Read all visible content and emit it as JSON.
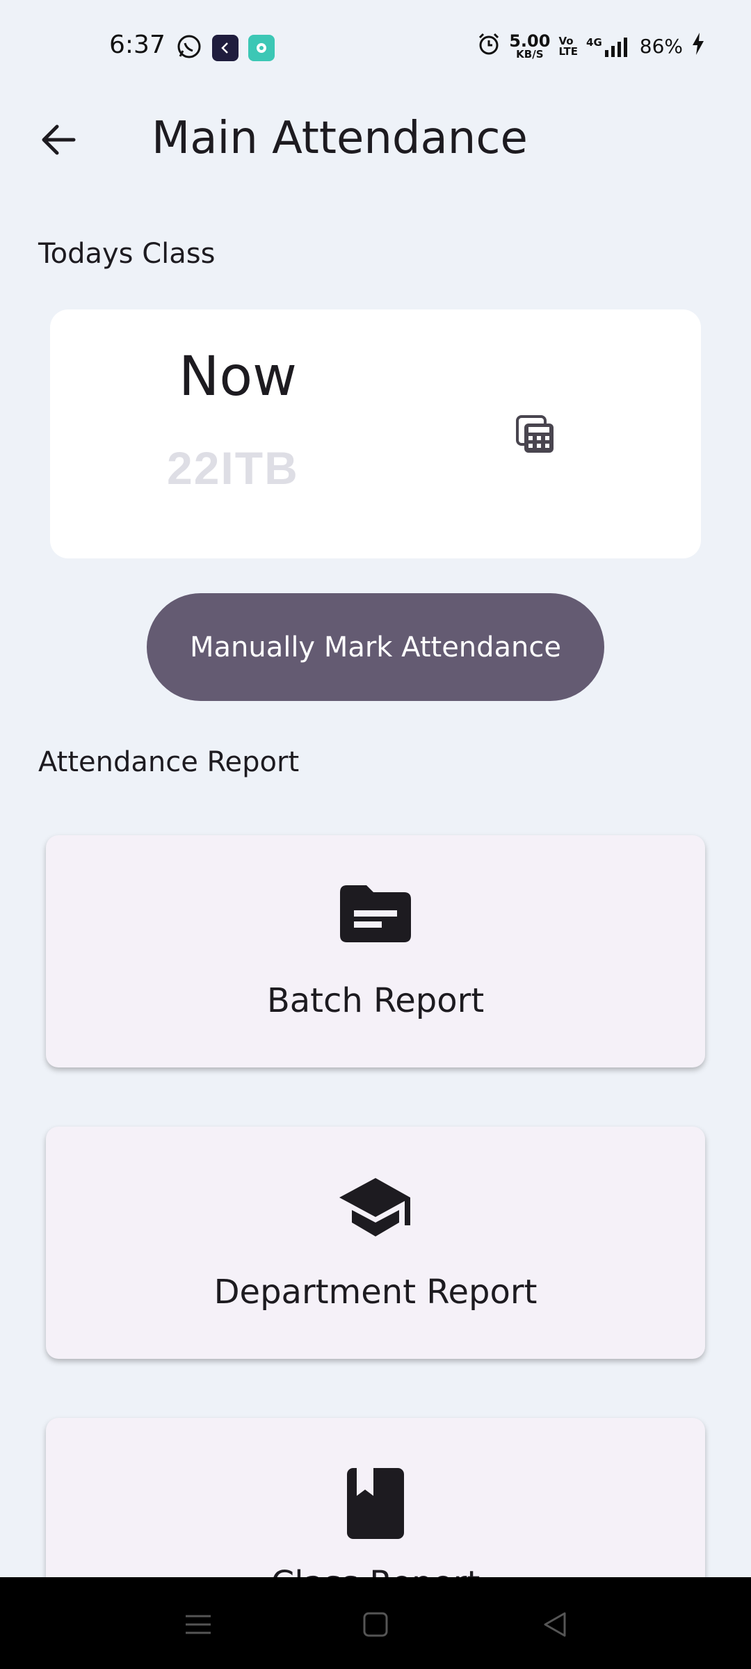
{
  "status_bar": {
    "time": "6:37",
    "net_speed_value": "5.00",
    "net_speed_unit": "KB/S",
    "volte_top": "Vo",
    "volte_bottom": "LTE",
    "network": "4G",
    "battery": "86%",
    "icons": [
      "whatsapp-icon",
      "app-icon",
      "app-icon-teal",
      "alarm-icon",
      "signal-icon",
      "charging-icon"
    ]
  },
  "app_bar": {
    "title": "Main Attendance",
    "back_icon": "arrow-left-icon"
  },
  "todays_class": {
    "section_label": "Todays Class",
    "status": "Now",
    "class_code": "22ITB",
    "icon": "calculator-icon"
  },
  "manual_button": {
    "label": "Manually Mark Attendance",
    "color": "#645b72"
  },
  "attendance_report": {
    "section_label": "Attendance Report",
    "cards": [
      {
        "label": "Batch Report",
        "icon": "folder-icon"
      },
      {
        "label": "Department Report",
        "icon": "graduation-cap-icon"
      },
      {
        "label": "Class Report",
        "icon": "bookmark-book-icon"
      }
    ]
  },
  "nav_bar": {
    "icons": [
      "menu-icon",
      "home-square-icon",
      "back-triangle-icon"
    ]
  }
}
